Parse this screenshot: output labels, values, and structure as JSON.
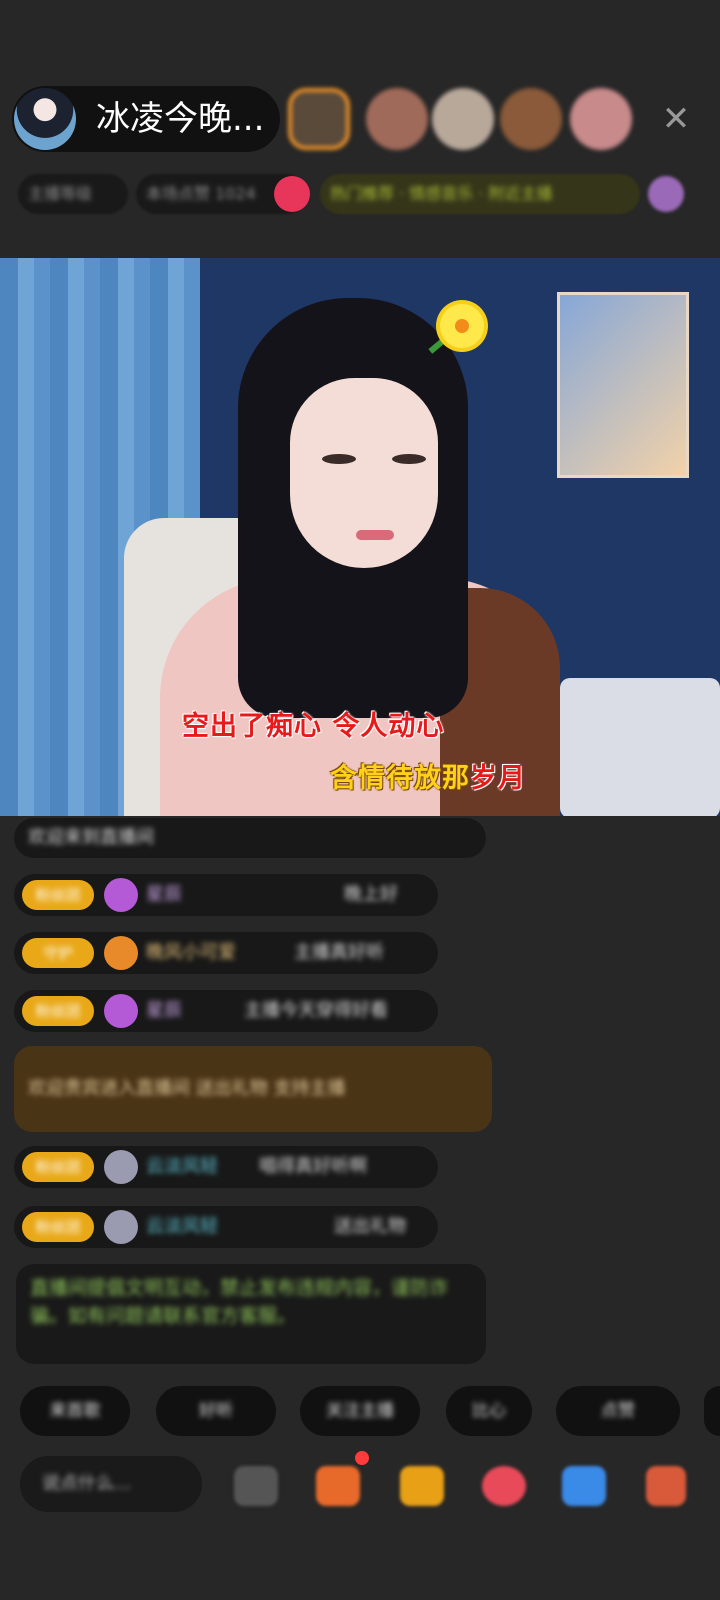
{
  "header": {
    "host_name": "冰凌今晚...",
    "close_icon": "close-icon",
    "viewers": [
      {
        "name": "viewer-avatar-1",
        "color": "#5a4a3a"
      },
      {
        "name": "viewer-avatar-2",
        "color": "#a06a5a"
      },
      {
        "name": "viewer-avatar-3",
        "color": "#b8a89a"
      },
      {
        "name": "viewer-avatar-4",
        "color": "#8a5a3a"
      },
      {
        "name": "viewer-avatar-5",
        "color": "#c88a8a"
      }
    ]
  },
  "info_row": {
    "chips": [
      "主播等级",
      "本场点赞 1024",
      "热门推荐 · 情感音乐 · 附近主播"
    ]
  },
  "video": {
    "lyric_line1": "空出了痴心  令人动心",
    "lyric_line2_yellow": "含情待放那",
    "lyric_line2_red": "岁月"
  },
  "chat": {
    "first_line": "欢迎来到直播间",
    "rows": [
      {
        "badge": "粉丝团",
        "gem_color": "#b55ad6",
        "nick": "星辰",
        "nick_color": "#c9a4e6",
        "text": "晚上好"
      },
      {
        "badge": "守护",
        "gem_color": "#e88a2a",
        "nick": "晚风小可爱",
        "nick_color": "#e6c27a",
        "text": "主播真好听"
      },
      {
        "badge": "粉丝团",
        "gem_color": "#b55ad6",
        "nick": "星辰",
        "nick_color": "#c9a4e6",
        "text": "主播今天穿得好看"
      },
      {
        "badge": "粉丝团",
        "gem_color": "#9a9ab0",
        "nick": "云淡风轻",
        "nick_color": "#5fc7d8",
        "text": "唱得真好听啊"
      },
      {
        "badge": "粉丝团",
        "gem_color": "#9a9ab0",
        "nick": "云淡风轻",
        "nick_color": "#5fc7d8",
        "text": "送出礼物"
      }
    ],
    "vip": {
      "text": "欢迎贵宾进入直播间 送出礼物 支持主播"
    },
    "system_msg": "直播间提倡文明互动，禁止发布违规内容，谨防诈骗。如有问题请联系官方客服。"
  },
  "quick_replies": [
    "来首歌",
    "好听",
    "关注主播",
    "比心",
    "点赞"
  ],
  "bottom_bar": {
    "input_placeholder": "说点什么...",
    "tools": [
      {
        "name": "emoji-icon",
        "color": "#555"
      },
      {
        "name": "gift-box-icon",
        "color": "#e86a2a"
      },
      {
        "name": "lucky-bag-icon",
        "color": "#e8a017"
      },
      {
        "name": "heart-gift-icon",
        "color": "#e84a5a"
      },
      {
        "name": "game-icon",
        "color": "#3a8ae8"
      },
      {
        "name": "more-icon",
        "color": "#d85a3a"
      }
    ]
  }
}
